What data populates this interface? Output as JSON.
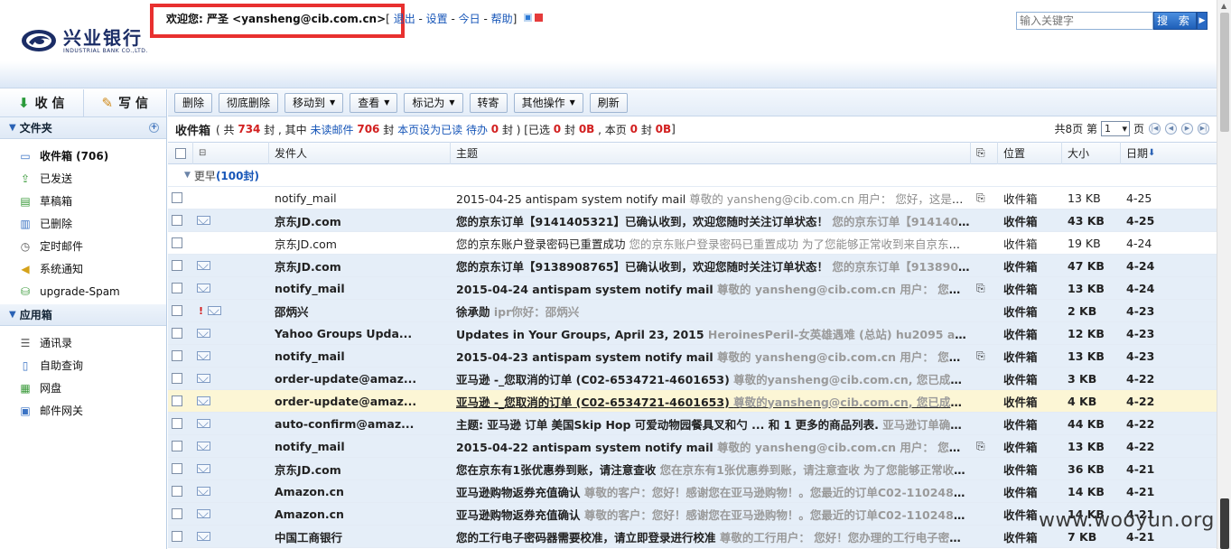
{
  "logo": {
    "cn": "兴业银行",
    "en": "INDUSTRIAL BANK CO.,LTD."
  },
  "userbar": {
    "welcome_prefix": "欢迎您:",
    "user": "严圣 <yansheng@cib.com.cn>",
    "bracket_open": "[",
    "links": [
      "退出",
      "设置",
      "今日",
      "帮助"
    ],
    "bracket_close": "]"
  },
  "search": {
    "placeholder": "输入关键字",
    "button": "搜 索"
  },
  "sidebar": {
    "compose": {
      "receive": "收 信",
      "write": "写 信"
    },
    "folders_title": "文件夹",
    "folders": [
      {
        "label": "收件箱 (706)",
        "icon": "inbox-icon"
      },
      {
        "label": "已发送",
        "icon": "sent-icon"
      },
      {
        "label": "草稿箱",
        "icon": "draft-icon"
      },
      {
        "label": "已删除",
        "icon": "trash-icon"
      },
      {
        "label": "定时邮件",
        "icon": "clock-icon"
      },
      {
        "label": "系统通知",
        "icon": "speaker-icon"
      },
      {
        "label": "upgrade-Spam",
        "icon": "spam-folder-icon"
      }
    ],
    "apps_title": "应用箱",
    "apps": [
      {
        "label": "通讯录",
        "icon": "contacts-icon"
      },
      {
        "label": "自助查询",
        "icon": "query-icon"
      },
      {
        "label": "网盘",
        "icon": "disk-icon"
      },
      {
        "label": "邮件网关",
        "icon": "gateway-icon"
      }
    ]
  },
  "toolbar": {
    "buttons": [
      {
        "label": "删除",
        "dropdown": false
      },
      {
        "label": "彻底删除",
        "dropdown": false
      },
      {
        "label": "移动到",
        "dropdown": true
      },
      {
        "label": "查看",
        "dropdown": true
      },
      {
        "label": "标记为",
        "dropdown": true
      },
      {
        "label": "转寄",
        "dropdown": false
      },
      {
        "label": "其他操作",
        "dropdown": true
      },
      {
        "label": "刷新",
        "dropdown": false
      }
    ]
  },
  "summary": {
    "title": "收件箱",
    "t1": "( 共",
    "total": "734",
    "t2": "封 , 其中",
    "unread_link": "未读邮件",
    "unread": "706",
    "t3": "封",
    "mark_read_link": "本页设为已读",
    "todo_link": "待办",
    "todo": "0",
    "t4": "封 ) [已选",
    "selected": "0",
    "t5": "封",
    "selected_size": "0B",
    "t6": ", 本页",
    "page_count": "0",
    "t7": "封",
    "page_size": "0B",
    "t8": "]"
  },
  "pager": {
    "prefix": "共8页 第",
    "current": "1",
    "suffix": "页"
  },
  "columns": {
    "sender": "发件人",
    "subject": "主题",
    "location": "位置",
    "size": "大小",
    "date": "日期"
  },
  "group": {
    "label": "更早",
    "count": "(100封)"
  },
  "emails": [
    {
      "sender": "notify_mail",
      "subject": "2015-04-25 antispam system notify mail",
      "preview": "尊敬的 yansheng@cib.com.cn 用户： 您好，这是反垃...",
      "attach": true,
      "location": "收件箱",
      "size": "13 KB",
      "date": "4-25",
      "unread": false,
      "hl": false,
      "flag": false,
      "env": false
    },
    {
      "sender": "京东JD.com",
      "subject": "您的京东订单【9141405321】已确认收到，欢迎您随时关注订单状态！",
      "preview": "您的京东订单【91414053...",
      "attach": false,
      "location": "收件箱",
      "size": "43 KB",
      "date": "4-25",
      "unread": true,
      "hl": false,
      "flag": false,
      "env": true
    },
    {
      "sender": "京东JD.com",
      "subject": "您的京东账户登录密码已重置成功",
      "preview": "您的京东账户登录密码已重置成功 为了您能够正常收到来自京东的优...",
      "attach": false,
      "location": "收件箱",
      "size": "19 KB",
      "date": "4-24",
      "unread": false,
      "hl": false,
      "flag": false,
      "env": false
    },
    {
      "sender": "京东JD.com",
      "subject": "您的京东订单【9138908765】已确认收到，欢迎您随时关注订单状态！",
      "preview": "您的京东订单【91389087...",
      "attach": false,
      "location": "收件箱",
      "size": "47 KB",
      "date": "4-24",
      "unread": true,
      "hl": false,
      "flag": false,
      "env": true
    },
    {
      "sender": "notify_mail",
      "subject": "2015-04-24 antispam system notify mail",
      "preview": "尊敬的 yansheng@cib.com.cn 用户： 您好，...",
      "attach": true,
      "location": "收件箱",
      "size": "13 KB",
      "date": "4-24",
      "unread": true,
      "hl": false,
      "flag": false,
      "env": true
    },
    {
      "sender": "邵炳兴",
      "subject": "徐承勋",
      "preview": "ipr你好：邵炳兴",
      "attach": false,
      "location": "收件箱",
      "size": "2 KB",
      "date": "4-23",
      "unread": true,
      "hl": false,
      "flag": true,
      "env": true
    },
    {
      "sender": "Yahoo Groups Upda...",
      "subject": "Updates in Your Groups, April 23, 2015",
      "preview": "HeroinesPeril-女英雄遇难 (总站) hu2095 add...",
      "attach": false,
      "location": "收件箱",
      "size": "12 KB",
      "date": "4-23",
      "unread": true,
      "hl": false,
      "flag": false,
      "env": true
    },
    {
      "sender": "notify_mail",
      "subject": "2015-04-23 antispam system notify mail",
      "preview": "尊敬的 yansheng@cib.com.cn 用户： 您好，...",
      "attach": true,
      "location": "收件箱",
      "size": "13 KB",
      "date": "4-23",
      "unread": true,
      "hl": false,
      "flag": false,
      "env": true
    },
    {
      "sender": "order-update@amaz...",
      "subject": "亚马逊 -_您取消的订单 (C02-6534721-4601653)",
      "preview": "尊敬的yansheng@cib.com.cn, 您已成功...",
      "attach": false,
      "location": "收件箱",
      "size": "3 KB",
      "date": "4-22",
      "unread": true,
      "hl": false,
      "flag": false,
      "env": true
    },
    {
      "sender": "order-update@amaz...",
      "subject": "亚马逊 -_您取消的订单 (C02-6534721-4601653)",
      "preview": "尊敬的yansheng@cib.com.cn, 您已成功...",
      "attach": false,
      "location": "收件箱",
      "size": "4 KB",
      "date": "4-22",
      "unread": true,
      "hl": true,
      "flag": false,
      "env": true
    },
    {
      "sender": "auto-confirm@amaz...",
      "subject": "主题: 亚马逊 订单 美国Skip Hop 可爱动物园餐具叉和勺 ... 和 1 更多的商品列表.",
      "preview": "亚马逊订单确认邮...",
      "attach": false,
      "location": "收件箱",
      "size": "44 KB",
      "date": "4-22",
      "unread": true,
      "hl": false,
      "flag": false,
      "env": true
    },
    {
      "sender": "notify_mail",
      "subject": "2015-04-22 antispam system notify mail",
      "preview": "尊敬的 yansheng@cib.com.cn 用户： 您好，...",
      "attach": true,
      "location": "收件箱",
      "size": "13 KB",
      "date": "4-22",
      "unread": true,
      "hl": false,
      "flag": false,
      "env": true
    },
    {
      "sender": "京东JD.com",
      "subject": "您在京东有1张优惠券到账，请注意查收",
      "preview": "您在京东有1张优惠券到账，请注意查收 为了您能够正常收到来...",
      "attach": false,
      "location": "收件箱",
      "size": "36 KB",
      "date": "4-21",
      "unread": true,
      "hl": false,
      "flag": false,
      "env": true
    },
    {
      "sender": "Amazon.cn",
      "subject": "亚马逊购物返券充值确认",
      "preview": "尊敬的客户：您好！感谢您在亚马逊购物！。您最近的订单C02-1102485-7...",
      "attach": false,
      "location": "收件箱",
      "size": "14 KB",
      "date": "4-21",
      "unread": true,
      "hl": false,
      "flag": false,
      "env": true
    },
    {
      "sender": "Amazon.cn",
      "subject": "亚马逊购物返券充值确认",
      "preview": "尊敬的客户：您好！感谢您在亚马逊购物！。您最近的订单C02-1102485-7...",
      "attach": false,
      "location": "收件箱",
      "size": "14 KB",
      "date": "4-21",
      "unread": true,
      "hl": false,
      "flag": false,
      "env": true
    },
    {
      "sender": "中国工商银行",
      "subject": "您的工行电子密码器需要校准，请立即登录进行校准",
      "preview": "尊敬的工行用户： 您好！您办理的工行电子密码器...",
      "attach": false,
      "location": "收件箱",
      "size": "7 KB",
      "date": "4-21",
      "unread": true,
      "hl": false,
      "flag": false,
      "env": true
    }
  ],
  "watermark": "www.wooyun.org"
}
